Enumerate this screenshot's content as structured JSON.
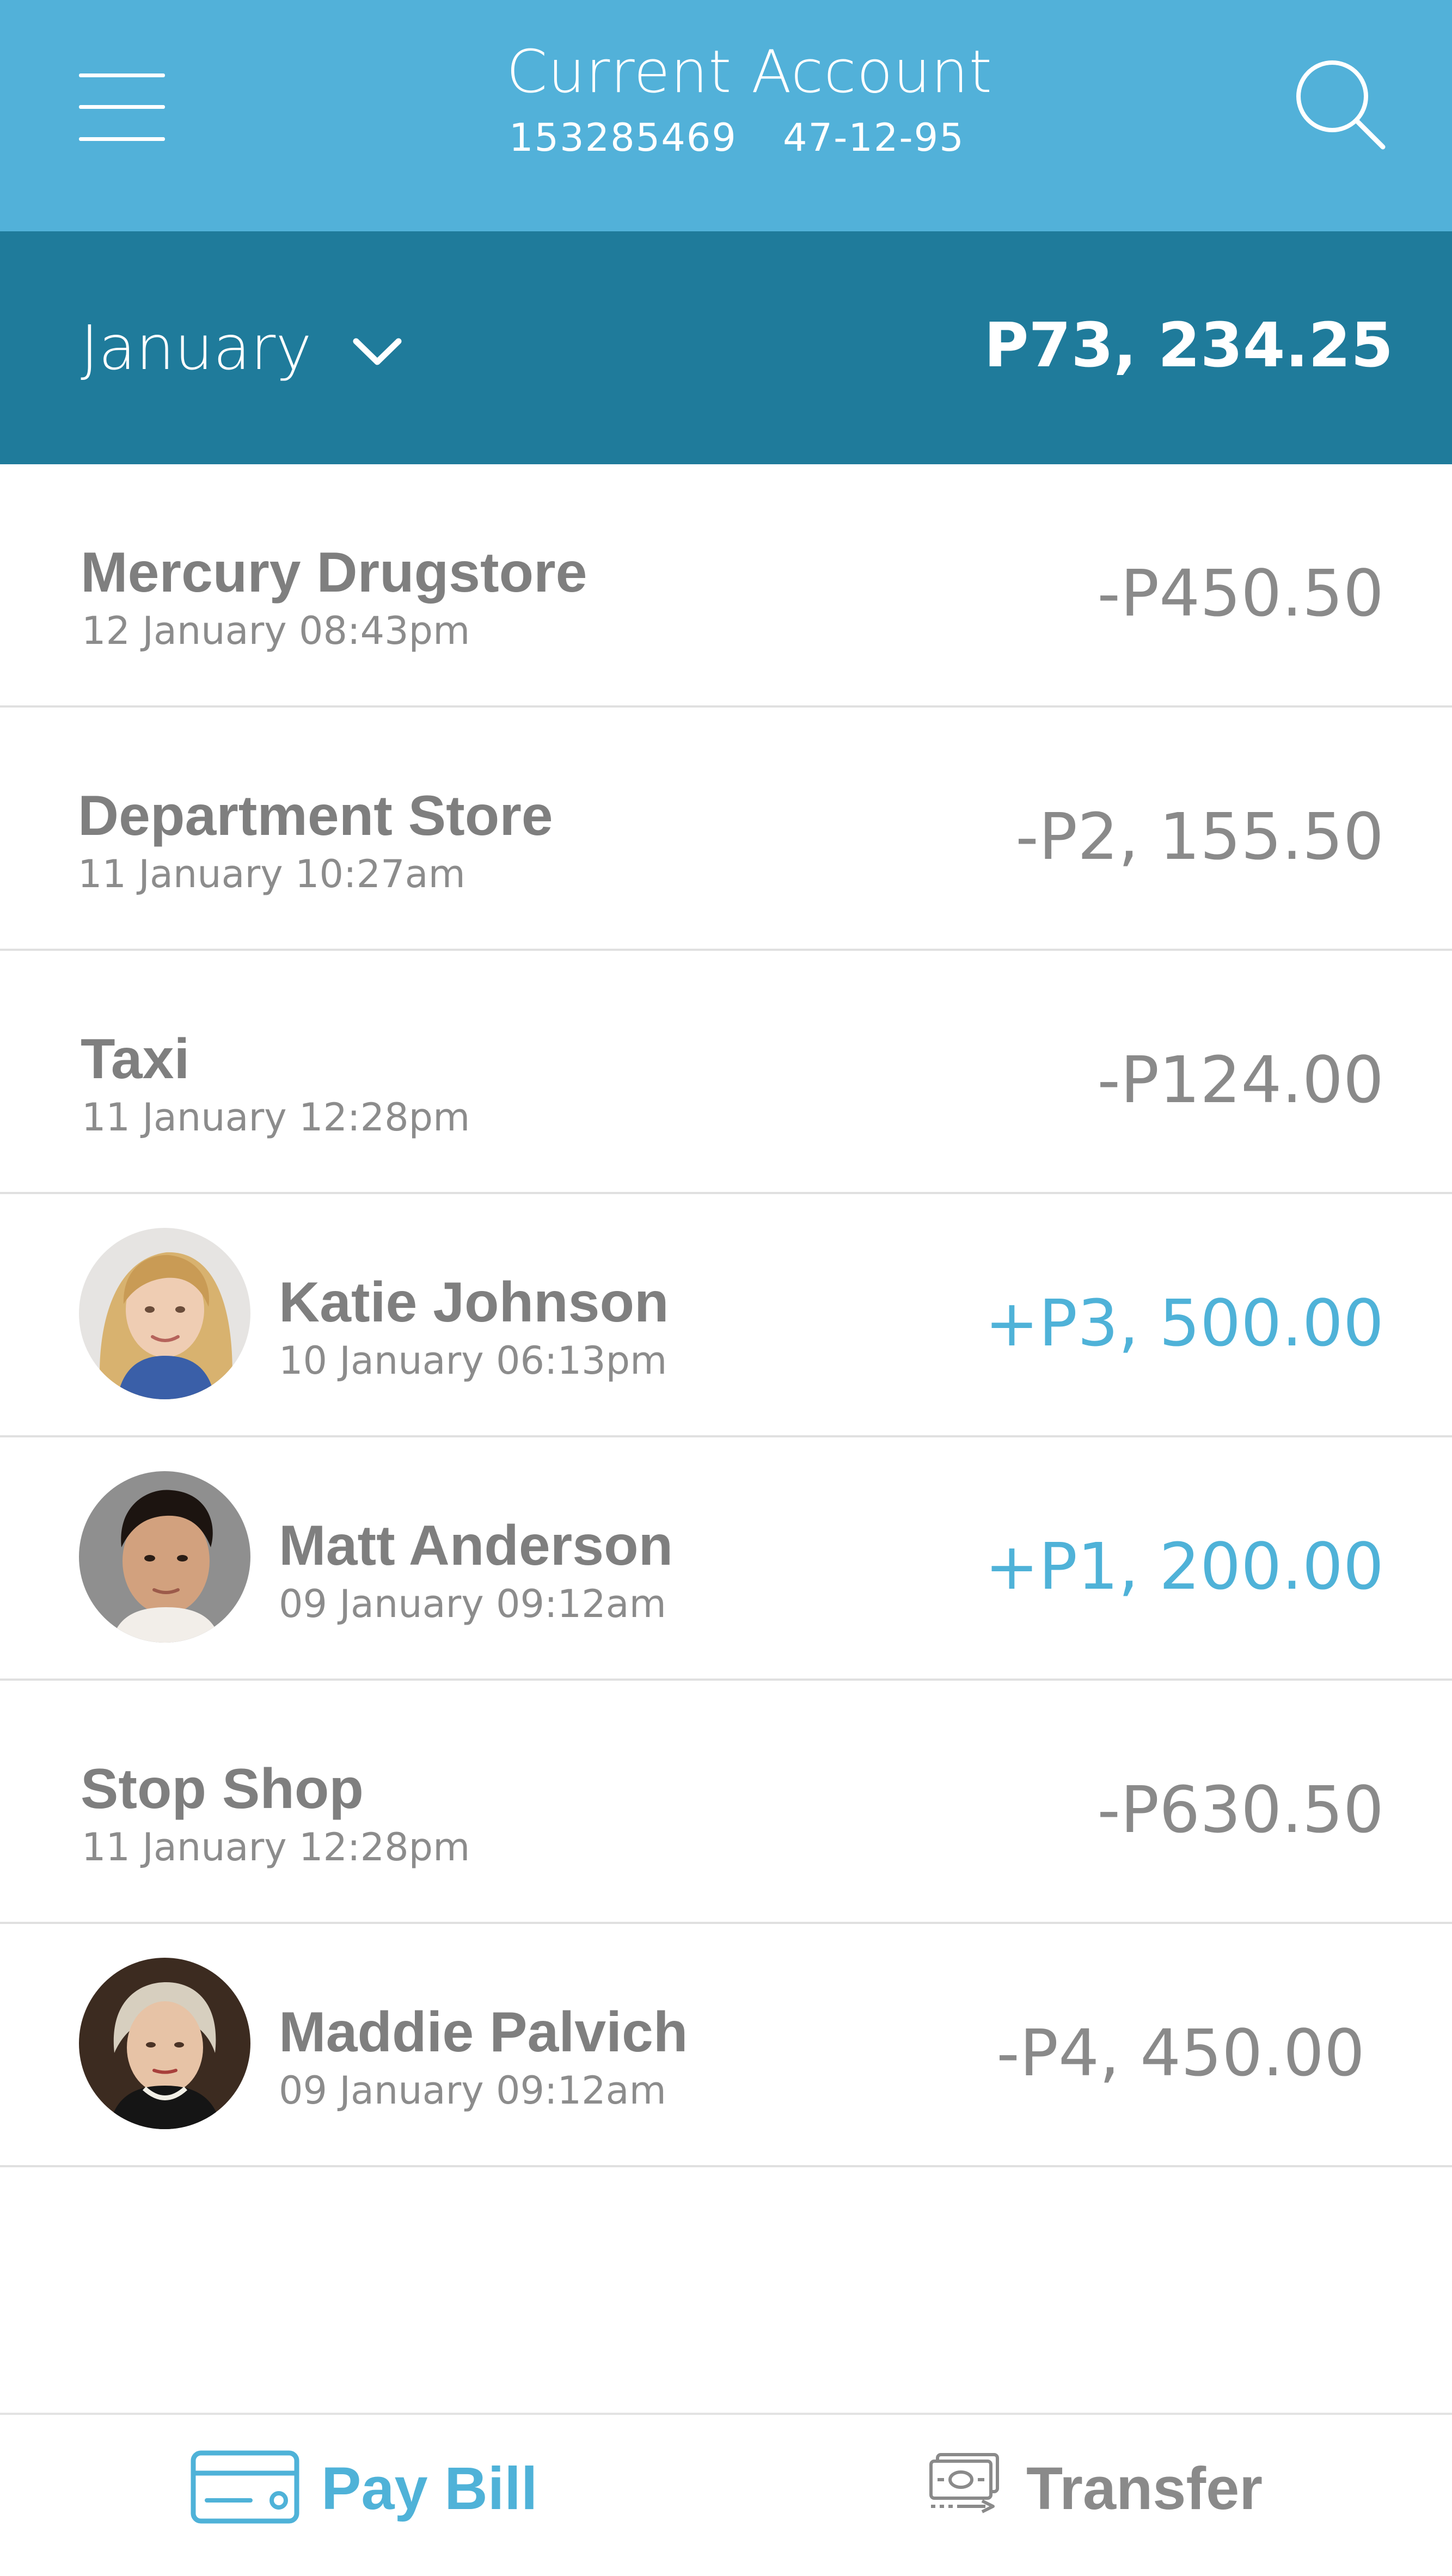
{
  "header": {
    "title": "Current Account",
    "account_number": "153285469",
    "sort_code": "47-12-95",
    "menu_icon": "hamburger-menu-icon",
    "search_icon": "search-icon",
    "background_color": "#52b1d9"
  },
  "month_bar": {
    "month": "January",
    "chevron_icon": "chevron-down-icon",
    "balance": "P73, 234.25",
    "background_color": "#1f7b9b"
  },
  "transactions": [
    {
      "name": "Mercury Drugstore",
      "date": "12 January 08:43pm",
      "amount": "-P450.50",
      "type": "debit",
      "has_avatar": false
    },
    {
      "name": "Department Store",
      "date": "11 January 10:27am",
      "amount": "-P2, 155.50",
      "type": "debit",
      "has_avatar": false
    },
    {
      "name": "Taxi",
      "date": "11 January 12:28pm",
      "amount": "-P124.00",
      "type": "debit",
      "has_avatar": false
    },
    {
      "name": "Katie Johnson",
      "date": "10 January 06:13pm",
      "amount": "+P3, 500.00",
      "type": "credit",
      "has_avatar": true
    },
    {
      "name": "Matt Anderson",
      "date": "09 January 09:12am",
      "amount": "+P1, 200.00",
      "type": "credit",
      "has_avatar": true
    },
    {
      "name": "Stop Shop",
      "date": "11 January 12:28pm",
      "amount": "-P630.50",
      "type": "debit",
      "has_avatar": false
    },
    {
      "name": "Maddie Palvich",
      "date": "09 January 09:12am",
      "amount": "-P4, 450.00",
      "type": "debit",
      "has_avatar": true
    }
  ],
  "bottom_bar": {
    "pay_bill_label": "Pay Bill",
    "pay_bill_icon": "credit-card-icon",
    "transfer_label": "Transfer",
    "transfer_icon": "money-transfer-icon"
  },
  "colors": {
    "credit": "#4fb2d8",
    "debit": "#8a8a8a",
    "accent": "#4fb2d8"
  }
}
